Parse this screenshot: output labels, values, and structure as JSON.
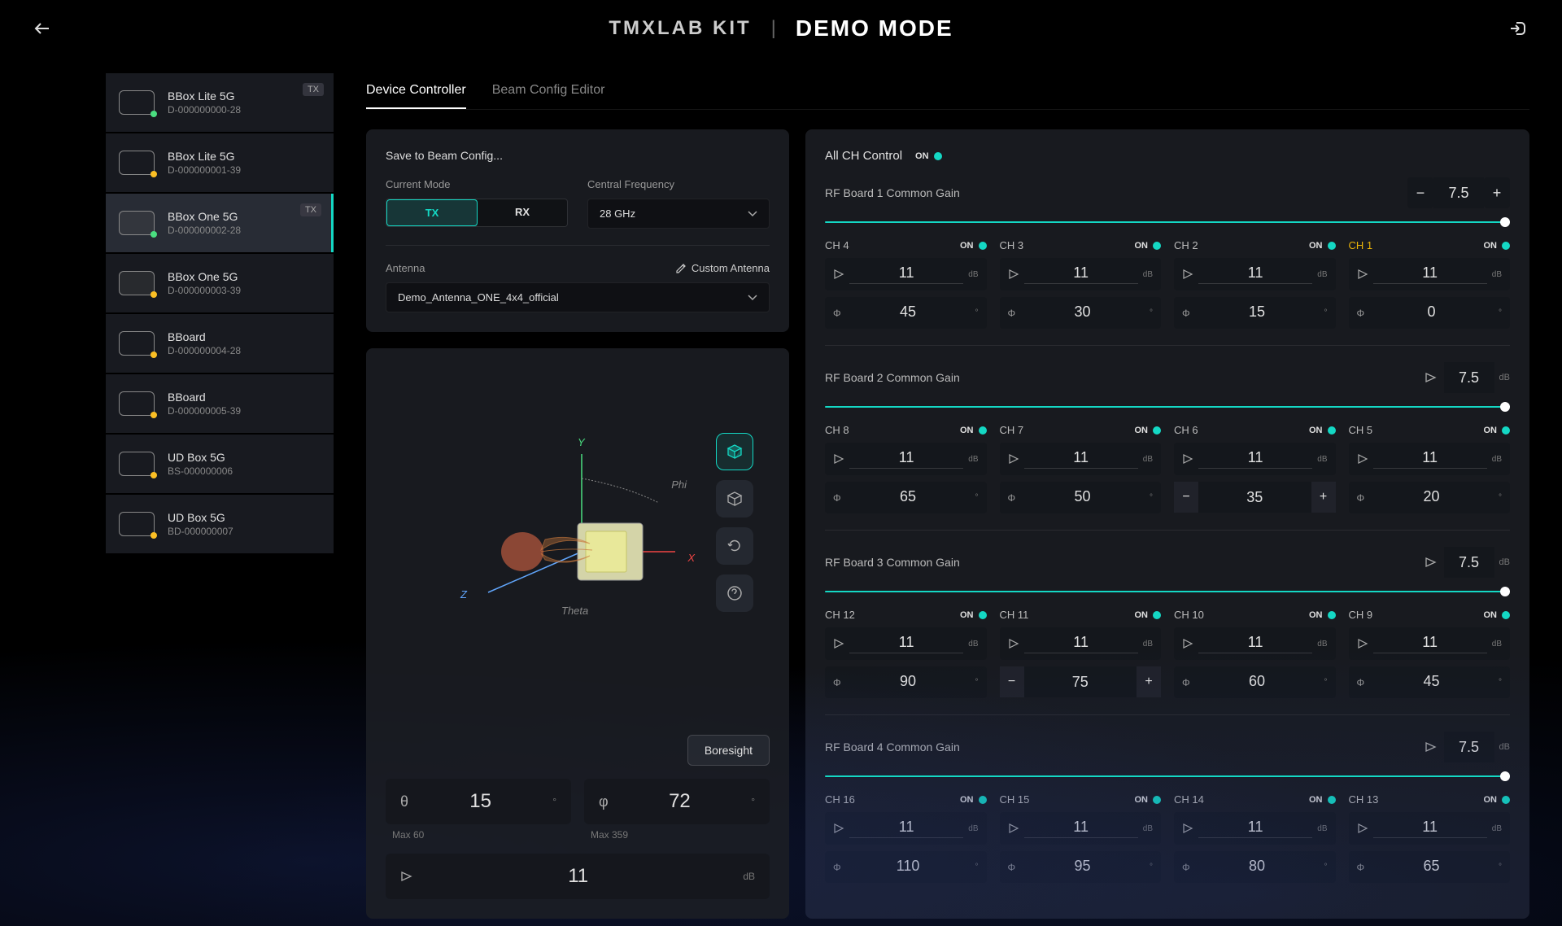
{
  "header": {
    "brand": "TMXLAB KIT",
    "mode": "DEMO MODE"
  },
  "tabs": {
    "t1": "Device Controller",
    "t2": "Beam Config Editor"
  },
  "sidebar": {
    "devices": [
      {
        "name": "BBox Lite 5G",
        "id": "D-000000000-28",
        "badge": "TX",
        "status": "green"
      },
      {
        "name": "BBox Lite 5G",
        "id": "D-000000001-39",
        "status": "yellow"
      },
      {
        "name": "BBox One 5G",
        "id": "D-000000002-28",
        "badge": "TX",
        "status": "green",
        "active": true
      },
      {
        "name": "BBox One 5G",
        "id": "D-000000003-39",
        "status": "yellow"
      },
      {
        "name": "BBoard",
        "id": "D-000000004-28",
        "status": "yellow"
      },
      {
        "name": "BBoard",
        "id": "D-000000005-39",
        "status": "yellow"
      },
      {
        "name": "UD Box 5G",
        "id": "BS-000000006",
        "status": "yellow"
      },
      {
        "name": "UD Box 5G",
        "id": "BD-000000007",
        "status": "yellow"
      }
    ]
  },
  "config": {
    "save_label": "Save to Beam Config...",
    "mode_label": "Current Mode",
    "tx": "TX",
    "rx": "RX",
    "freq_label": "Central Frequency",
    "freq_value": "28 GHz",
    "antenna_label": "Antenna",
    "custom_antenna": "Custom Antenna",
    "antenna_value": "Demo_Antenna_ONE_4x4_official"
  },
  "viz": {
    "y": "Y",
    "x": "X",
    "z": "Z",
    "phi": "Phi",
    "theta": "Theta",
    "boresight": "Boresight",
    "theta_sym": "θ",
    "theta_val": "15",
    "theta_max": "Max 60",
    "phi_sym": "φ",
    "phi_val": "72",
    "phi_max": "Max 359",
    "gain_val": "11",
    "gain_unit": "dB",
    "deg": "°"
  },
  "channels": {
    "all_label": "All CH Control",
    "on": "ON",
    "boards": [
      {
        "title": "RF Board 1 Common Gain",
        "gain": "7.5",
        "has_pm": true,
        "chs": [
          {
            "name": "CH 4",
            "db": "11",
            "deg": "45"
          },
          {
            "name": "CH 3",
            "db": "11",
            "deg": "30"
          },
          {
            "name": "CH 2",
            "db": "11",
            "deg": "15"
          },
          {
            "name": "CH 1",
            "db": "11",
            "deg": "0",
            "highlight": true
          }
        ]
      },
      {
        "title": "RF Board 2 Common Gain",
        "gain": "7.5",
        "unit": "dB",
        "chs": [
          {
            "name": "CH 8",
            "db": "11",
            "deg": "65"
          },
          {
            "name": "CH 7",
            "db": "11",
            "deg": "50"
          },
          {
            "name": "CH 6",
            "db": "11",
            "deg": "35",
            "deg_pm": true
          },
          {
            "name": "CH 5",
            "db": "11",
            "deg": "20"
          }
        ]
      },
      {
        "title": "RF Board 3 Common Gain",
        "gain": "7.5",
        "unit": "dB",
        "chs": [
          {
            "name": "CH 12",
            "db": "11",
            "deg": "90"
          },
          {
            "name": "CH 11",
            "db": "11",
            "deg": "75",
            "deg_pm": true
          },
          {
            "name": "CH 10",
            "db": "11",
            "deg": "60"
          },
          {
            "name": "CH 9",
            "db": "11",
            "deg": "45"
          }
        ]
      },
      {
        "title": "RF Board 4 Common Gain",
        "gain": "7.5",
        "unit": "dB",
        "chs": [
          {
            "name": "CH 16",
            "db": "11",
            "deg": "110"
          },
          {
            "name": "CH 15",
            "db": "11",
            "deg": "95"
          },
          {
            "name": "CH 14",
            "db": "11",
            "deg": "80"
          },
          {
            "name": "CH 13",
            "db": "11",
            "deg": "65"
          }
        ]
      }
    ],
    "db": "dB",
    "deg": "°",
    "minus": "−",
    "plus": "+"
  }
}
